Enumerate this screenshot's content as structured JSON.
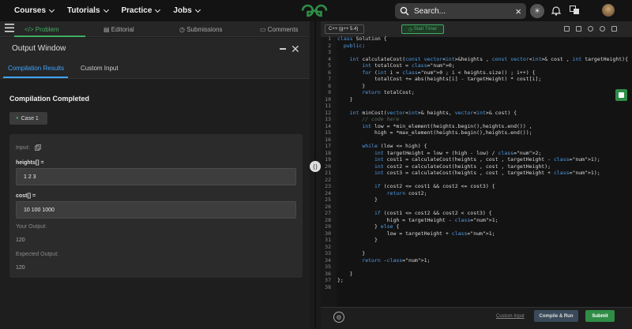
{
  "nav": {
    "items": [
      "Courses",
      "Tutorials",
      "Practice",
      "Jobs"
    ],
    "search_placeholder": "Search..."
  },
  "problem_tabs": [
    "Problem",
    "Editorial",
    "Submissions",
    "Comments"
  ],
  "output": {
    "title": "Output Window",
    "tabs": [
      "Compilation Results",
      "Custom Input"
    ],
    "status": "Compilation Completed",
    "case_label": "Case 1",
    "input_label": "Input:",
    "heights_label": "heights[] =",
    "heights_value": "1 2 3",
    "cost_label": "cost[] =",
    "cost_value": "10 100 1000",
    "your_output_label": "Your Output:",
    "your_output_value": "120",
    "expected_output_label": "Expected Output:",
    "expected_output_value": "120"
  },
  "editor": {
    "language": "C++ (g++ 5.4)",
    "timer_label": "Start Timer",
    "custom_input_label": "Custom Input",
    "compile_run_label": "Compile & Run",
    "submit_label": "Submit"
  },
  "colors": {
    "accent_green": "#2f8d46",
    "accent_blue": "#3ea6ff"
  },
  "code_lines": [
    "class Solution {",
    "  public:",
    "",
    "    int calculateCost(const vector<int>&heights , const vector<int>& cost , int targetHeight){",
    "        int totalCost = 0;",
    "        for (int i = 0 ; i < heights.size() ; i++) {",
    "            totalCost += abs(heights[i] - targetHeight) * cost[i];",
    "        }",
    "        return totalCost;",
    "    }",
    "",
    "    int minCost(vector<int>& heights, vector<int>& cost) {",
    "        // code here",
    "        int low = *min_element(heights.begin(),heights.end()) ,",
    "            high = *max_element(heights.begin(),heights.end());",
    "",
    "        while (low <= high) {",
    "            int targetHeight = low + (high - low) / 2;",
    "            int cost1 = calculateCost(heights , cost , targetHeight - 1);",
    "            int cost2 = calculateCost(heights , cost , targetHeight);",
    "            int cost3 = calculateCost(heights , cost , targetHeight + 1);",
    "",
    "            if (cost2 <= cost1 && cost2 <= cost3) {",
    "                return cost2;",
    "            }",
    "",
    "            if (cost1 <= cost2 && cost2 < cost3) {",
    "                high = targetHeight - 1;",
    "            } else {",
    "                low = targetHeight + 1;",
    "            }",
    "",
    "        }",
    "        return -1;",
    "",
    "    }",
    "};",
    ""
  ]
}
